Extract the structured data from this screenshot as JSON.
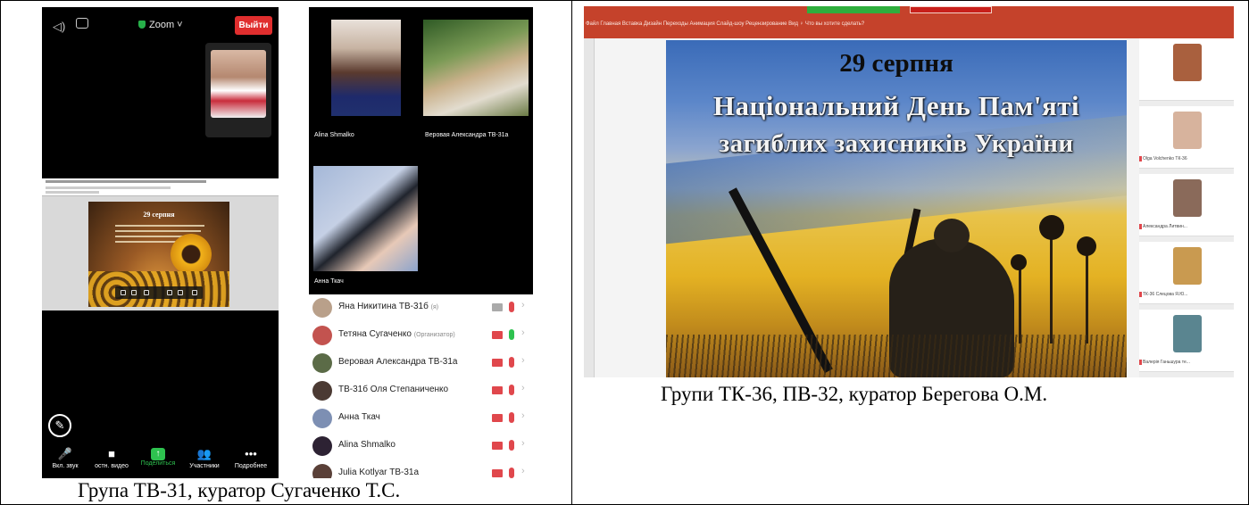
{
  "left": {
    "caption": "Група ТВ-31, куратор Сугаченко Т.С.",
    "phone": {
      "meeting_name": "Zoom ˅",
      "leave_label": "Выйти",
      "toolbar": [
        {
          "icon": "muted-mic-icon",
          "glyph": "🎤",
          "label": "Вкл. звук"
        },
        {
          "icon": "video-icon",
          "glyph": "■",
          "label": "остн. видео"
        },
        {
          "icon": "share-icon",
          "glyph": "↑",
          "label": "Поделиться"
        },
        {
          "icon": "participants-icon",
          "glyph": "👥",
          "label": "Участники"
        },
        {
          "icon": "more-icon",
          "glyph": "•••",
          "label": "Подробнее"
        }
      ],
      "slide_title": "29 серпня"
    },
    "participants": {
      "videos": [
        {
          "name": "Alina Shmalko"
        },
        {
          "name": "Веровая Александра ТВ-31а"
        },
        {
          "name": "Анна Ткач"
        }
      ],
      "list": [
        {
          "name": "Яна Никитина ТВ-31б",
          "role": "(я)",
          "avatar_color": "#b9a08a",
          "video_on": false,
          "mic_on": false
        },
        {
          "name": "Тетяна Сугаченко",
          "role": "(Организатор)",
          "avatar_color": "#c3534f",
          "video_on": true,
          "mic_on": true
        },
        {
          "name": "Веровая Александра ТВ-31а",
          "role": "",
          "avatar_color": "#5b6b47",
          "video_on": true,
          "mic_on": false
        },
        {
          "name": "ТВ-31б Оля Степаниченко",
          "role": "",
          "avatar_color": "#4b3a33",
          "video_on": true,
          "mic_on": false
        },
        {
          "name": "Анна Ткач",
          "role": "",
          "avatar_color": "#7d8fb3",
          "video_on": true,
          "mic_on": false
        },
        {
          "name": "Alina Shmalko",
          "role": "",
          "avatar_color": "#2d2233",
          "video_on": true,
          "mic_on": false
        },
        {
          "name": "Julia Kotlyar ТВ-31а",
          "role": "",
          "avatar_color": "#5a4038",
          "video_on": true,
          "mic_on": false
        }
      ]
    }
  },
  "right": {
    "caption": "Групи ТК-36, ПВ-32, куратор Берегова О.М.",
    "ribbon_menu": "Файл   Главная   Вставка   Дизайн   Переходы   Анимация   Слайд-шоу   Рецензирование   Вид   ♀ Что вы хотите сделать?",
    "slide": {
      "line1": "29 серпня",
      "line2": "Національний День Пам'яті",
      "line3": "загиблих захисників України"
    },
    "gallery": [
      {
        "name": "",
        "color": "#a9603e"
      },
      {
        "name": "Olga Volchenko ТК-36",
        "color": "#d7b39d"
      },
      {
        "name": "Александра Литвин...",
        "color": "#8a6a5a"
      },
      {
        "name": "ТК-36 Слецова Я.Ю...",
        "color": "#c99a50"
      },
      {
        "name": "Валерія Ганьшура те...",
        "color": "#5a8590"
      }
    ]
  }
}
